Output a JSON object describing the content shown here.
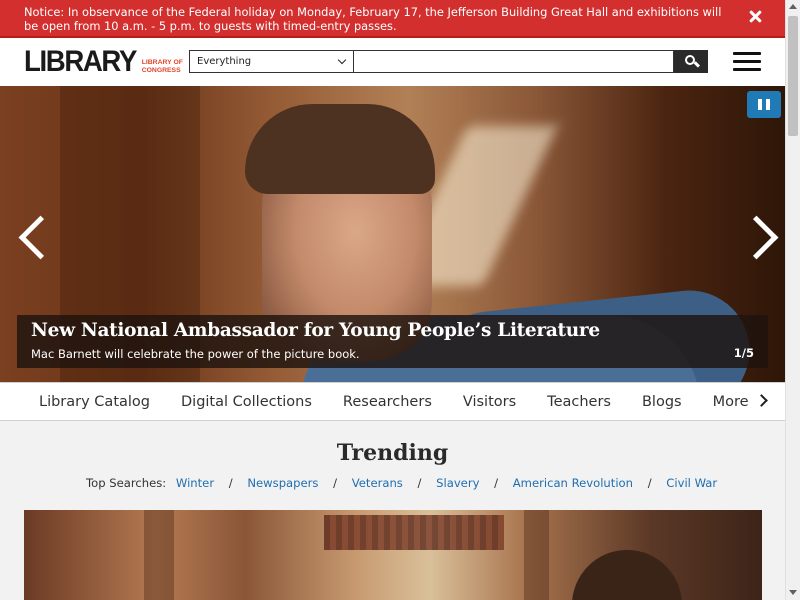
{
  "notice": {
    "text": "Notice: In observance of the Federal holiday on Monday, February 17, the Jefferson Building Great Hall and exhibitions will be open from 10 a.m. - 5 p.m. to guests with timed-entry passes.",
    "close_icon": "close-icon"
  },
  "header": {
    "logo_word": "LIBRARY",
    "logo_sub": "LIBRARY OF CONGRESS",
    "search_scope": "Everything",
    "search_value": "",
    "search_icon": "search-icon",
    "menu_icon": "hamburger-menu-icon"
  },
  "hero": {
    "title": "New National Ambassador for Young People’s Literature",
    "subtitle": "Mac Barnett will celebrate the power of the picture book.",
    "counter": "1/5",
    "pause_icon": "pause-icon",
    "prev_icon": "chevron-left-icon",
    "next_icon": "chevron-right-icon",
    "accent_color": "#1f7ab5"
  },
  "tabs": {
    "items": [
      "Library Catalog",
      "Digital Collections",
      "Researchers",
      "Visitors",
      "Teachers",
      "Blogs",
      "More"
    ],
    "next_icon": "chevron-right-icon"
  },
  "trending": {
    "title": "Trending",
    "top_searches_label": "Top Searches:",
    "links": [
      "Winter",
      "Newspapers",
      "Veterans",
      "Slavery",
      "American Revolution",
      "Civil War"
    ],
    "separator": "/"
  },
  "colors": {
    "notice_bg": "#d32f2f",
    "logo_accent": "#e4442b",
    "link": "#1f6fb0"
  }
}
